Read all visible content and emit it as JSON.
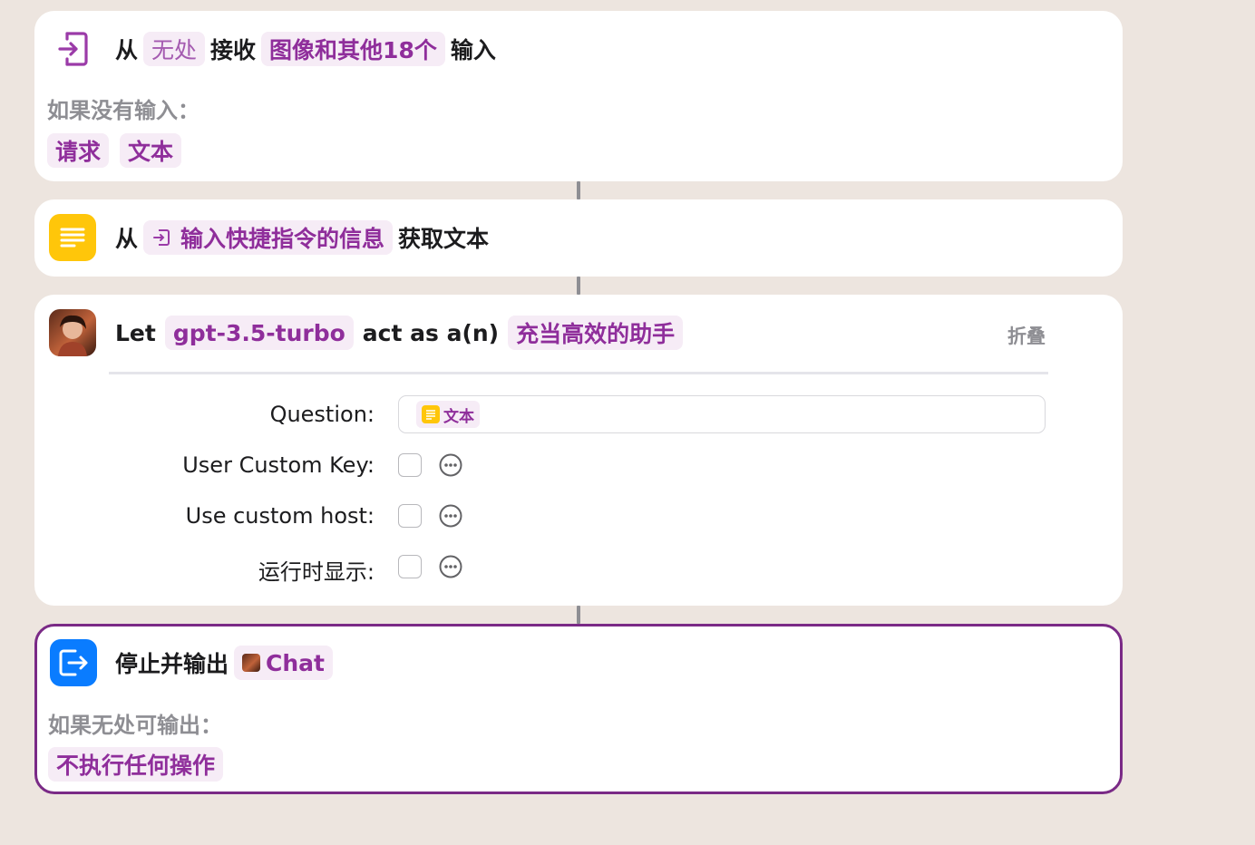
{
  "receive": {
    "from": "从",
    "source": "无处",
    "receive": "接收",
    "types": "图像和其他18个",
    "input": "输入",
    "no_input_label": "如果没有输入：",
    "option1": "请求",
    "option2": "文本"
  },
  "get_text": {
    "from": "从",
    "source": "输入快捷指令的信息",
    "action": "获取文本"
  },
  "gpt": {
    "let": "Let",
    "model": "gpt-3.5-turbo",
    "act_as": "act as a(n)",
    "role": "充当高效的助手",
    "collapse": "折叠",
    "question_label": "Question:",
    "question_value": "文本",
    "user_key_label": "User Custom Key:",
    "custom_host_label": "Use custom host:",
    "show_when_run_label": "运行时显示:"
  },
  "stop": {
    "action": "停止并输出",
    "value": "Chat",
    "no_output_label": "如果无处可输出：",
    "option": "不执行任何操作"
  },
  "colors": {
    "background": "#ede5df",
    "pill_bg": "#f6ecf6",
    "pill_text": "#8f2e9b",
    "selected_border": "#7a2a86",
    "text_icon": "#ffc60a",
    "stop_icon": "#0a7cff"
  }
}
